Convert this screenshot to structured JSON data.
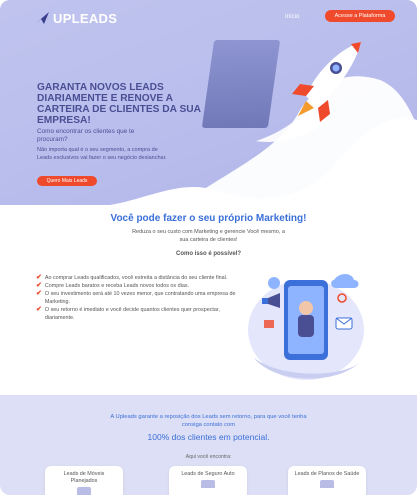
{
  "brand": {
    "name": "UPLEADS"
  },
  "nav": {
    "home_label": "Início",
    "cta_label": "Acesse a Plataforma"
  },
  "hero": {
    "title": "GARANTA NOVOS LEADS DIARIAMENTE E RENOVE A CARTEIRA DE CLIENTES DA SUA EMPRESA!",
    "question": "Como encontrar os clientes que te procuram?",
    "description": "Não importa qual é o seu segmento, a compra de Leads exclusivos vai fazer o seu negócio deslanchar.",
    "more_button": "Quero Mais Leads"
  },
  "marketing": {
    "title": "Você pode fazer o seu próprio Marketing!",
    "subtitle": "Reduza o seu custo com Marketing e gerencie Você mesmo, a sua carteira de clientes!",
    "question": "Como isso é possível?",
    "benefits": [
      "Ao comprar Leads qualificados, você estreita a distância do seu cliente final.",
      "Compre Leads baratos e receba Leads novos todos os dias.",
      "O seu investimento será até 10 vezes menor, que contratando uma empresa de Marketing.",
      "O seu retorno é imediato e você decide quantos clientes quer prospectar, diariamente."
    ]
  },
  "guarantee": {
    "text": "A Upleads garante a reposição dos Leads sem retorno, para que você tenha consiga contato com",
    "highlight": "100% dos clientes em potencial.",
    "find_label": "Aqui você encontra:",
    "cards": [
      "Leads de Móveis Planejados",
      "Leads de Seguro Auto",
      "Leads de Planos de Saúde"
    ]
  },
  "colors": {
    "accent": "#ef4a2c",
    "primary": "#3b6fd9",
    "hero_text": "#4a4f94",
    "band": "#dcdff5"
  },
  "icons": [
    "logo-arrow-icon",
    "rocket-icon",
    "check-icon",
    "phone-marketing-illustration"
  ]
}
